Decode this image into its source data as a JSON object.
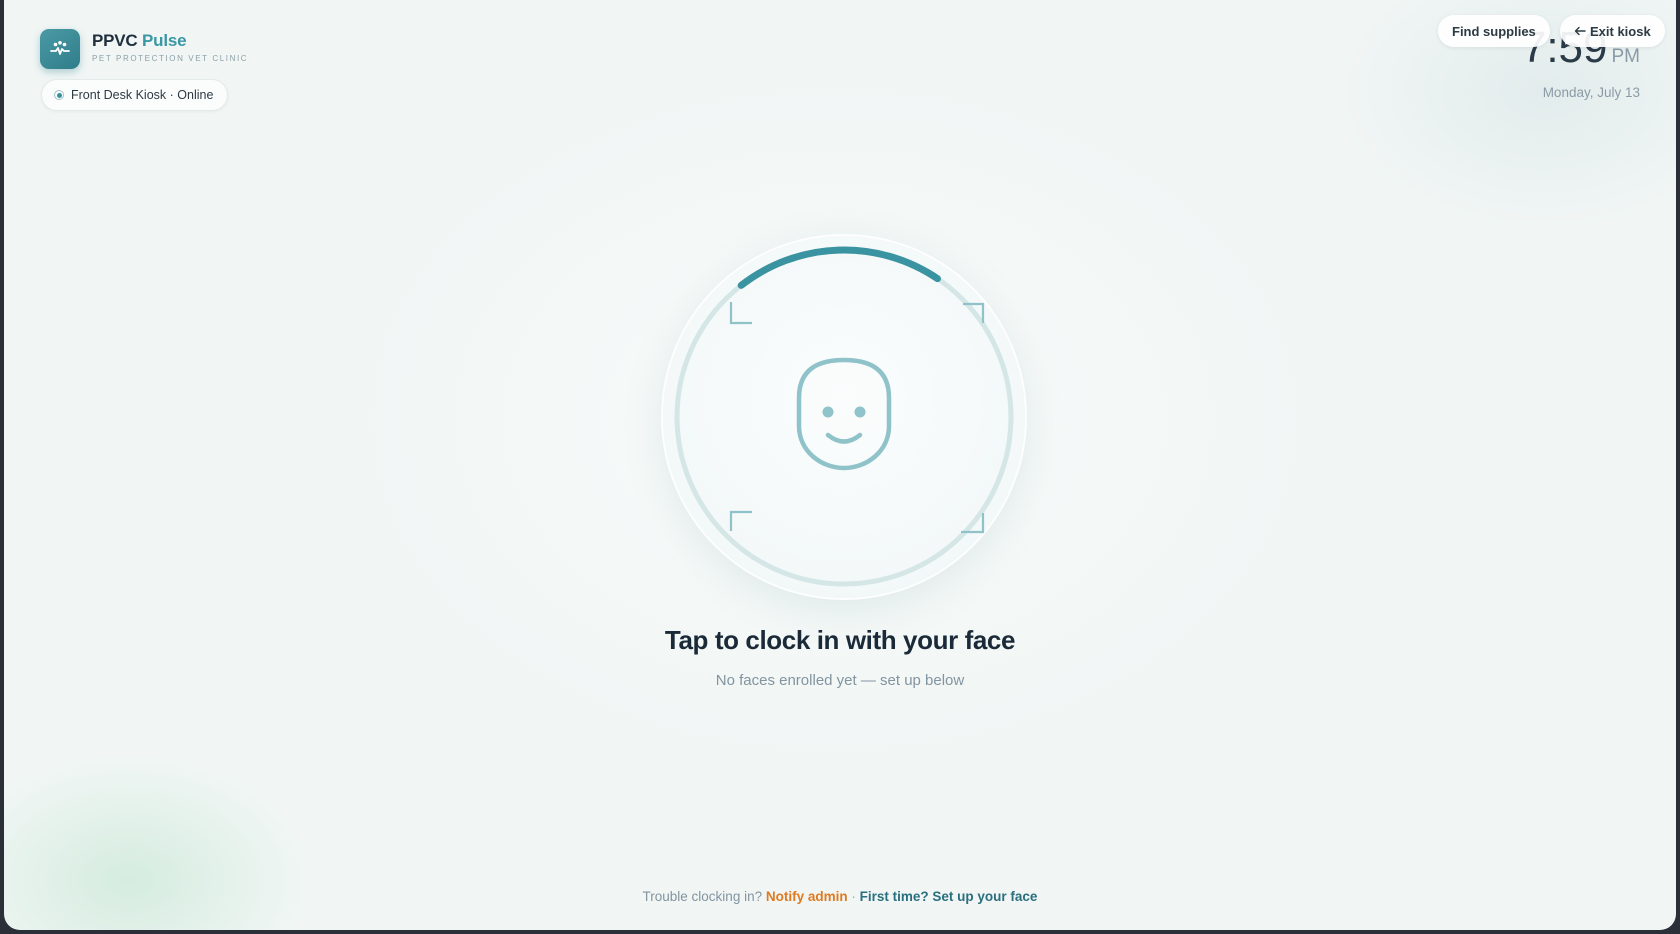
{
  "brand": {
    "name": "PPVC",
    "accent": "Pulse",
    "subtitle": "PET PROTECTION VET CLINIC",
    "logo_icon": "paw-pulse-icon"
  },
  "status": {
    "label": "Front Desk Kiosk · Online",
    "icon": "online-dot-icon"
  },
  "header": {
    "find_supplies_label": "Find supplies",
    "exit_label": "Exit kiosk",
    "exit_icon": "arrow-left-icon"
  },
  "clock": {
    "time": "7:59",
    "ampm": "PM",
    "date": "Monday, July 13"
  },
  "scanner": {
    "icon": "face-icon",
    "progress": 0.2
  },
  "main": {
    "headline": "Tap to clock in with your face",
    "subline": "No faces enrolled yet — set up below"
  },
  "footer": {
    "trouble_text": "Trouble clocking in?",
    "notify_label": "Notify admin",
    "separator": "·",
    "setup_label": "First time? Set up your face"
  },
  "colors": {
    "accent": "#3a97a4",
    "warning_link": "#e07a1f",
    "link": "#2a6f7e",
    "text_dark": "#1a2a38",
    "text_muted": "#8294a0"
  }
}
